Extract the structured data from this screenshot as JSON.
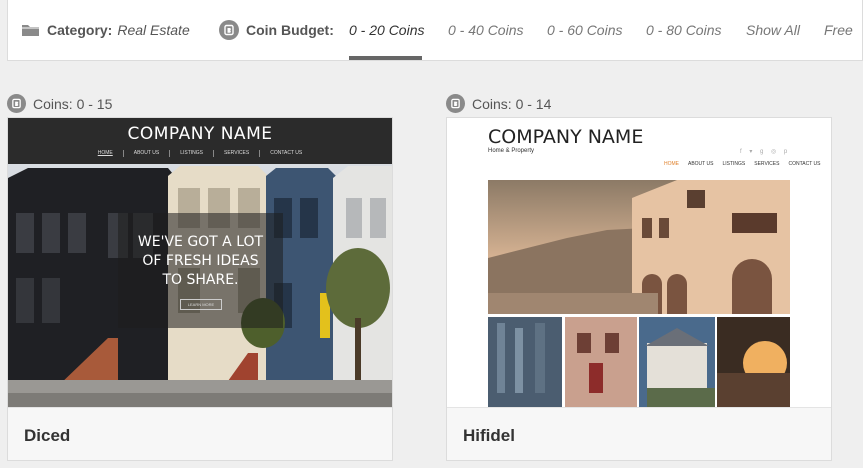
{
  "filter": {
    "category_label": "Category:",
    "category_value": "Real Estate",
    "budget_label": "Coin Budget:",
    "options": [
      "0 - 20 Coins",
      "0 - 40 Coins",
      "0 - 60 Coins",
      "0 - 80 Coins",
      "Show All",
      "Free"
    ],
    "active_option": "0 - 20 Coins"
  },
  "templates": [
    {
      "coins": "Coins: 0 - 15",
      "name": "Diced",
      "preview": {
        "logo": "COMPANY NAME",
        "nav": [
          "HOME",
          "ABOUT US",
          "LISTINGS",
          "SERVICES",
          "CONTACT US"
        ],
        "tagline": [
          "WE'VE GOT A LOT",
          "OF FRESH IDEAS",
          "TO SHARE."
        ],
        "button": "LEARN MORE"
      }
    },
    {
      "coins": "Coins: 0 - 14",
      "name": "Hifidel",
      "preview": {
        "logo": "COMPANY NAME",
        "subtitle": "Home & Property",
        "nav": [
          "HOME",
          "ABOUT US",
          "LISTINGS",
          "SERVICES",
          "CONTACT US"
        ]
      }
    }
  ],
  "colors": {
    "accent": "#666666",
    "hifidel_active_nav": "#e0832f"
  },
  "icons": {
    "category": "folder-icon",
    "coin": "coin-icon"
  }
}
